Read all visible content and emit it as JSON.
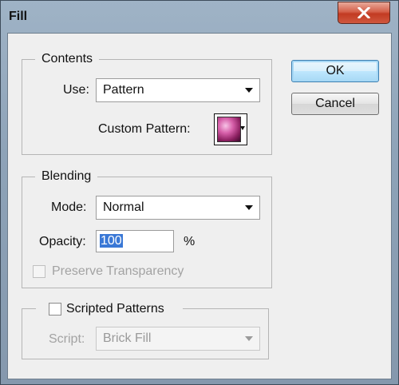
{
  "window": {
    "title": "Fill"
  },
  "contents": {
    "legend": "Contents",
    "use_label": "Use:",
    "use_value": "Pattern",
    "custom_pattern_label": "Custom Pattern:"
  },
  "blending": {
    "legend": "Blending",
    "mode_label": "Mode:",
    "mode_value": "Normal",
    "opacity_label": "Opacity:",
    "opacity_value": "100",
    "opacity_unit": "%",
    "preserve_label": "Preserve Transparency",
    "preserve_checked": false,
    "preserve_enabled": false
  },
  "scripted": {
    "checkbox_label": "Scripted Patterns",
    "checked": false,
    "script_label": "Script:",
    "script_value": "Brick Fill",
    "script_enabled": false
  },
  "buttons": {
    "ok": "OK",
    "cancel": "Cancel"
  },
  "colors": {
    "title_bar": "#8ea3b8",
    "close_button": "#c23a22",
    "selection": "#3a78d6",
    "default_button": "#a7d9f5"
  },
  "icons": [
    "close-icon",
    "pattern-swatch",
    "dropdown-arrow-icon"
  ]
}
